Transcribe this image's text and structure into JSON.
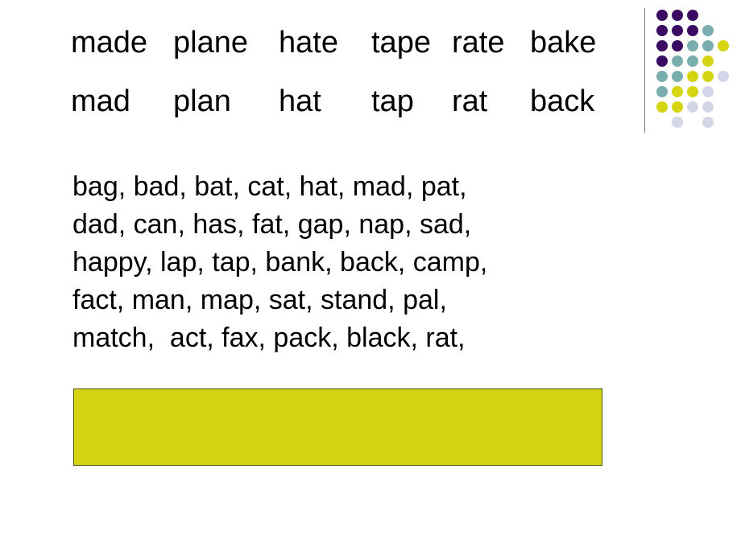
{
  "slide": {
    "background_color": "#ffffff",
    "word_table": {
      "rows": [
        {
          "name": "long-vowel-row",
          "cells": [
            "made",
            "plane",
            "hate",
            "tape",
            "rate",
            "bake"
          ]
        },
        {
          "name": "short-vowel-row",
          "cells": [
            "mad",
            "plan",
            "hat",
            "tap",
            "rat",
            "back"
          ]
        }
      ]
    },
    "word_list": {
      "lines": [
        "bag, bad, bat, cat, hat, mad, pat,",
        "dad, can, has, fat, gap, nap, sad,",
        "happy, lap, tap, bank, back, camp,",
        "fact, man, map, sat, stand, pal,",
        "match,  act, fax, pack, black, rat,"
      ]
    },
    "yellow_box": {
      "label": "",
      "fill_color": "#d4d411",
      "border_color": "#4d4d17"
    },
    "divider": {
      "color": "#808080"
    },
    "dot_logo": {
      "name": "decorative-dot-matrix-logo",
      "colors": {
        "purple": "#3b0b63",
        "teal": "#7aadad",
        "yellow": "#d4d411",
        "lavender": "#d5d5e8"
      },
      "cell_size": 19,
      "dot_size": 14,
      "grid": [
        [
          "purple",
          "purple",
          "purple",
          "",
          ""
        ],
        [
          "purple",
          "purple",
          "purple",
          "teal",
          ""
        ],
        [
          "purple",
          "purple",
          "teal",
          "teal",
          "yellow"
        ],
        [
          "purple",
          "teal",
          "teal",
          "yellow",
          ""
        ],
        [
          "teal",
          "teal",
          "yellow",
          "yellow",
          "lavender"
        ],
        [
          "teal",
          "yellow",
          "yellow",
          "lavender",
          ""
        ],
        [
          "yellow",
          "yellow",
          "lavender",
          "lavender",
          ""
        ],
        [
          "",
          "lavender",
          "",
          "lavender",
          ""
        ]
      ]
    }
  }
}
